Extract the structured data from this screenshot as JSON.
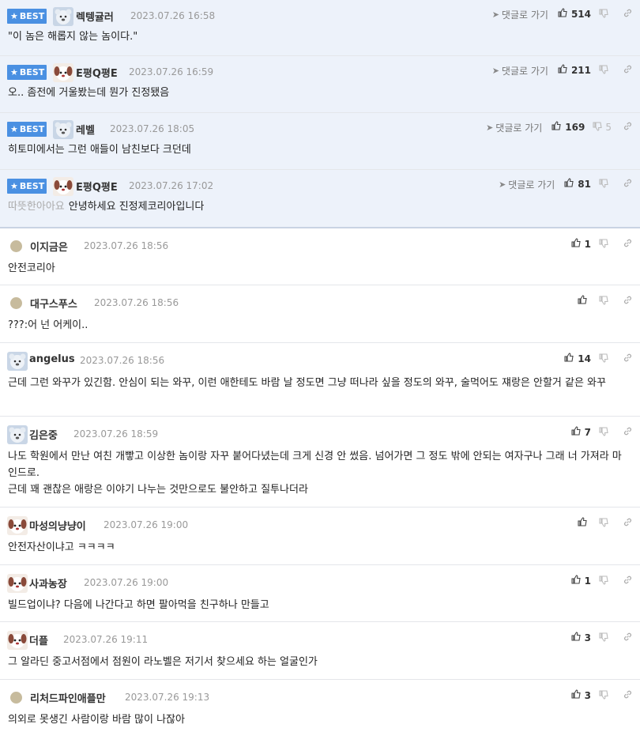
{
  "badge_label": "BEST",
  "goto_label": "댓글로 가기",
  "best": [
    {
      "nick": "렉텡귤러",
      "time": "2023.07.26 16:58",
      "text": "\"이 놈은 해롭지 않는 놈이다.\"",
      "up": "514",
      "down": "",
      "avatar": "bear-avatar"
    },
    {
      "nick": "E평Q평E",
      "time": "2023.07.26 16:59",
      "text": "오.. 좀전에 거울봤는데 뭔가 진정됐음",
      "up": "211",
      "down": "",
      "avatar": "dog-avatar"
    },
    {
      "nick": "레벨",
      "time": "2023.07.26 18:05",
      "text": "히토미에서는 그런 애들이 남친보다 크던데",
      "up": "169",
      "down": "5",
      "avatar": "bear-avatar"
    },
    {
      "nick": "E평Q평E",
      "time": "2023.07.26 17:02",
      "hint": "따뜻한아아요",
      "text": "안녕하세요 진정제코리아입니다",
      "up": "81",
      "down": "",
      "avatar": "dog-avatar"
    }
  ],
  "comments": [
    {
      "nick": "이지금은",
      "time": "2023.07.26 18:56",
      "lines": [
        "안전코리아"
      ],
      "up": "1",
      "avatar": "dot-avatar"
    },
    {
      "nick": "대구스푸스",
      "time": "2023.07.26 18:56",
      "lines": [
        "???:어 넌 어케이.."
      ],
      "up": "",
      "avatar": "dot-avatar"
    },
    {
      "nick": "angelus",
      "time": "2023.07.26 18:56",
      "lines": [
        "근데 그런 와꾸가 있긴함. 안심이 되는 와꾸, 이런 애한테도 바람 날 정도면 그냥 떠나라 싶을 정도의 와꾸, 술먹어도 쟤랑은 안할거 같은 와꾸"
      ],
      "up": "14",
      "avatar": "bear-avatar"
    },
    {
      "nick": "김은중",
      "time": "2023.07.26 18:59",
      "lines": [
        "나도 학원에서 만난 여친 개빻고 이상한 놈이랑 자꾸 붙어다녔는데 크게 신경 안 썼음. 넘어가면 그 정도 밖에 안되는 여자구나 그래 너 가져라 마인드로.",
        "근데 꽤 괜찮은 애랑은 이야기 나누는 것만으로도 불안하고 질투나더라"
      ],
      "up": "7",
      "avatar": "bear-avatar"
    },
    {
      "nick": "마성의냥냥이",
      "time": "2023.07.26 19:00",
      "lines": [
        "안전자산이냐고 ㅋㅋㅋㅋ"
      ],
      "up": "",
      "avatar": "dog-avatar"
    },
    {
      "nick": "사과농장",
      "time": "2023.07.26 19:00",
      "lines": [
        "빌드업이냐? 다음에 나간다고 하면 팔아먹을 친구하나 만들고"
      ],
      "up": "1",
      "avatar": "dog-avatar"
    },
    {
      "nick": "더플",
      "time": "2023.07.26 19:11",
      "lines": [
        "그 알라딘 중고서점에서 점원이 라노벨은 저기서 찾으세요 하는 얼굴인가"
      ],
      "up": "3",
      "avatar": "dog-avatar"
    },
    {
      "nick": "리처드파인애플만",
      "time": "2023.07.26 19:13",
      "lines": [
        "의외로 못생긴 사람이랑 바람 많이 나잖아"
      ],
      "up": "3",
      "avatar": "dot-avatar"
    }
  ]
}
